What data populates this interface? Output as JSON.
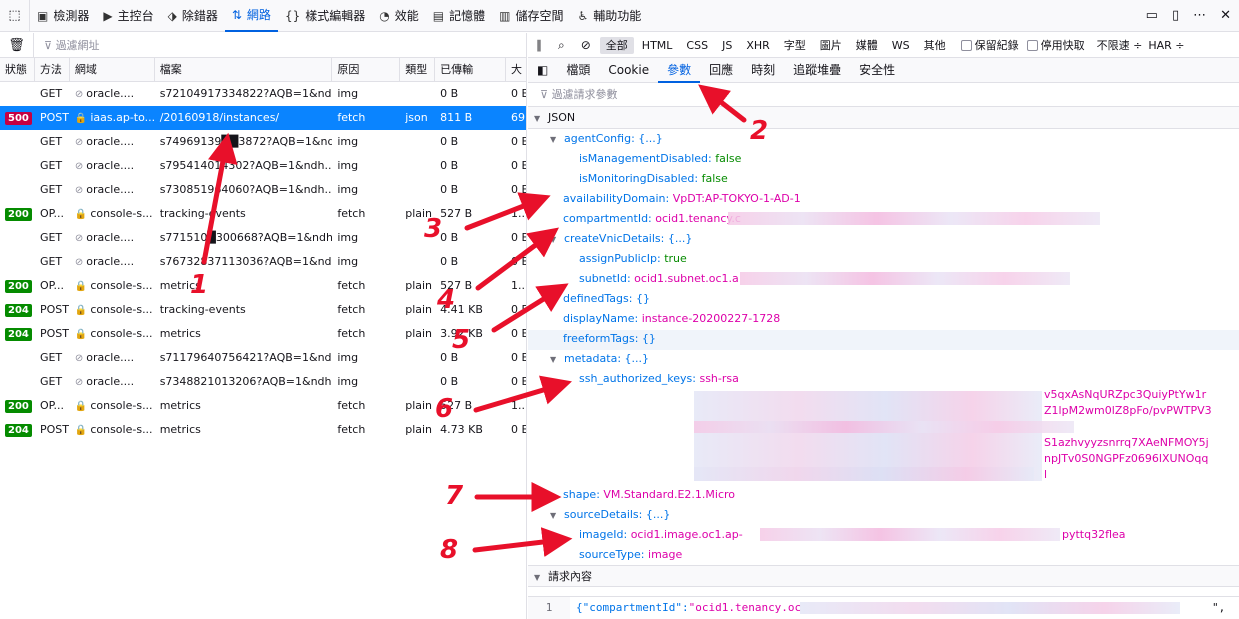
{
  "toolbar": {
    "tabs": [
      {
        "label": "檢測器",
        "icon": "inspector-icon"
      },
      {
        "label": "主控台",
        "icon": "console-icon"
      },
      {
        "label": "除錯器",
        "icon": "debugger-icon"
      },
      {
        "label": "網路",
        "icon": "network-icon",
        "active": true
      },
      {
        "label": "樣式編輯器",
        "icon": "style-editor-icon"
      },
      {
        "label": "效能",
        "icon": "performance-icon"
      },
      {
        "label": "記憶體",
        "icon": "memory-icon"
      },
      {
        "label": "儲存空間",
        "icon": "storage-icon"
      },
      {
        "label": "輔助功能",
        "icon": "accessibility-icon"
      }
    ]
  },
  "left": {
    "filter_placeholder": "過濾網址",
    "columns": [
      "狀態",
      "方法",
      "網域",
      "檔案",
      "原因",
      "類型",
      "已傳輸",
      "大"
    ],
    "rows": [
      {
        "status": "",
        "method": "GET",
        "domain": "oracle....",
        "file": "s72104917334822?AQB=1&nd...",
        "cause": "img",
        "type": "",
        "size": "0 B",
        "big": "0 E"
      },
      {
        "status": "500",
        "method": "POST",
        "domain": "iaas.ap-to...",
        "file": "/20160918/instances/",
        "cause": "fetch",
        "type": "json",
        "size": "811 B",
        "big": "69",
        "selected": true
      },
      {
        "status": "",
        "method": "GET",
        "domain": "oracle....",
        "file": "s74969139██3872?AQB=1&nd...",
        "cause": "img",
        "type": "",
        "size": "0 B",
        "big": "0 E"
      },
      {
        "status": "",
        "method": "GET",
        "domain": "oracle....",
        "file": "s795414014302?AQB=1&ndh...",
        "cause": "img",
        "type": "",
        "size": "0 B",
        "big": "0 E"
      },
      {
        "status": "",
        "method": "GET",
        "domain": "oracle....",
        "file": "s730851964060?AQB=1&ndh...",
        "cause": "img",
        "type": "",
        "size": "0 B",
        "big": "0 E"
      },
      {
        "status": "200",
        "method": "OP...",
        "domain": "console-s...",
        "file": "tracking-events",
        "cause": "fetch",
        "type": "plain",
        "size": "527 B",
        "big": "1..."
      },
      {
        "status": "",
        "method": "GET",
        "domain": "oracle....",
        "file": "s771510█300668?AQB=1&ndh...",
        "cause": "img",
        "type": "",
        "size": "0 B",
        "big": "0 E"
      },
      {
        "status": "",
        "method": "GET",
        "domain": "oracle....",
        "file": "s76732837113036?AQB=1&nd...",
        "cause": "img",
        "type": "",
        "size": "0 B",
        "big": "0 E"
      },
      {
        "status": "200",
        "method": "OP...",
        "domain": "console-s...",
        "file": "metrics",
        "cause": "fetch",
        "type": "plain",
        "size": "527 B",
        "big": "1..."
      },
      {
        "status": "204",
        "method": "POST",
        "domain": "console-s...",
        "file": "tracking-events",
        "cause": "fetch",
        "type": "plain",
        "size": "4.41 KB",
        "big": "0 E"
      },
      {
        "status": "204",
        "method": "POST",
        "domain": "console-s...",
        "file": "metrics",
        "cause": "fetch",
        "type": "plain",
        "size": "3.92 KB",
        "big": "0 E"
      },
      {
        "status": "",
        "method": "GET",
        "domain": "oracle....",
        "file": "s71179640756421?AQB=1&nd...",
        "cause": "img",
        "type": "",
        "size": "0 B",
        "big": "0 E"
      },
      {
        "status": "",
        "method": "GET",
        "domain": "oracle....",
        "file": "s7348821013206?AQB=1&ndh...",
        "cause": "img",
        "type": "",
        "size": "0 B",
        "big": "0 E"
      },
      {
        "status": "200",
        "method": "OP...",
        "domain": "console-s...",
        "file": "metrics",
        "cause": "fetch",
        "type": "plain",
        "size": "527 B",
        "big": "1..."
      },
      {
        "status": "204",
        "method": "POST",
        "domain": "console-s...",
        "file": "metrics",
        "cause": "fetch",
        "type": "plain",
        "size": "4.73 KB",
        "big": "0 E"
      }
    ]
  },
  "right": {
    "filters": [
      "全部",
      "HTML",
      "CSS",
      "JS",
      "XHR",
      "字型",
      "圖片",
      "媒體",
      "WS",
      "其他"
    ],
    "persist_label": "保留紀錄",
    "disable_cache_label": "停用快取",
    "throttle_label": "不限速 ÷",
    "har_label": "HAR ÷",
    "tabs": [
      "檔頭",
      "Cookie",
      "參數",
      "回應",
      "時刻",
      "追蹤堆疊",
      "安全性"
    ],
    "param_filter_placeholder": "過濾請求參數",
    "json_section": "JSON",
    "request_section": "請求內容",
    "json": {
      "agentConfig": "agentConfig:",
      "agentConfig_v": "{...}",
      "isManagementDisabled": "isManagementDisabled:",
      "isManagementDisabled_v": "false",
      "isMonitoringDisabled": "isMonitoringDisabled:",
      "isMonitoringDisabled_v": "false",
      "availabilityDomain": "availabilityDomain:",
      "availabilityDomain_v": "VpDT:AP-TOKYO-1-AD-1",
      "compartmentId": "compartmentId:",
      "compartmentId_v": "ocid1.tenancy.c",
      "createVnicDetails": "createVnicDetails:",
      "createVnicDetails_v": "{...}",
      "assignPublicIp": "assignPublicIp:",
      "assignPublicIp_v": "true",
      "subnetId": "subnetId:",
      "subnetId_v": "ocid1.subnet.oc1.a",
      "definedTags": "definedTags:",
      "definedTags_v": "{}",
      "displayName": "displayName:",
      "displayName_v": "instance-20200227-1728",
      "freeformTags": "freeformTags:",
      "freeformTags_v": "{}",
      "metadata": "metadata:",
      "metadata_v": "{...}",
      "ssh_authorized_keys": "ssh_authorized_keys:",
      "ssh_authorized_keys_v": "ssh-rsa",
      "ssh_frag1": "v5qxAsNqURZpc3QuiyPtYw1r",
      "ssh_frag2": "Z1lpM2wm0lZ8pFo/pvPWTPV3",
      "ssh_frag3": "S1azhvyyzsnrrq7XAeNFMOY5j",
      "ssh_frag4": "npJTv0S0NGPFz0696lXUNOqq",
      "ssh_frag5": "l",
      "shape": "shape:",
      "shape_v": "VM.Standard.E2.1.Micro",
      "sourceDetails": "sourceDetails:",
      "sourceDetails_v": "{...}",
      "imageId": "imageId:",
      "imageId_v": "ocid1.image.oc1.ap-",
      "imageId_tail": "pyttq32flea",
      "sourceType": "sourceType:",
      "sourceType_v": "image"
    },
    "code_line_no": "1",
    "code_key": "{\"compartmentId\":",
    "code_val": "\"ocid1.tenancy.oc",
    "code_tail": "\","
  },
  "annotations": [
    "1",
    "2",
    "3",
    "4",
    "5",
    "6",
    "7",
    "8"
  ],
  "colors": {
    "accent": "#0061e0",
    "selected_row": "#0a84ff",
    "arrow": "#e8102a",
    "json_key": "#0074e8",
    "json_string": "#dd00a9",
    "json_bool": "#058b00"
  }
}
